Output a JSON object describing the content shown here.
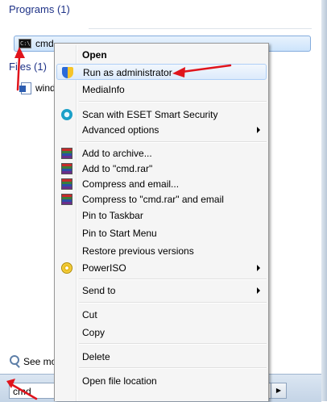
{
  "start_menu": {
    "programs_header": "Programs (1)",
    "files_header": "Files (1)",
    "program_result": {
      "label": "cmd",
      "icon": "cmd-icon"
    },
    "file_result": {
      "label": "wind",
      "icon": "word-document-icon"
    },
    "see_more": "See mo",
    "search": {
      "value": "cmd",
      "go_icon": "play-arrow-icon"
    }
  },
  "context_menu": {
    "open": "Open",
    "run_as_admin": "Run as administrator",
    "mediainfo": "MediaInfo",
    "scan_eset": "Scan with ESET Smart Security",
    "advanced_options": "Advanced options",
    "add_to_archive": "Add to archive...",
    "add_to_cmd_rar": "Add to \"cmd.rar\"",
    "compress_email": "Compress and email...",
    "compress_cmd_rar_email": "Compress to \"cmd.rar\" and email",
    "pin_taskbar": "Pin to Taskbar",
    "pin_start": "Pin to Start Menu",
    "restore_versions": "Restore previous versions",
    "poweriso": "PowerISO",
    "send_to": "Send to",
    "cut": "Cut",
    "copy": "Copy",
    "delete": "Delete",
    "open_location": "Open file location"
  },
  "colors": {
    "annotation_arrow": "#e0141c",
    "header_text": "#1e3287",
    "highlight_border": "#aecff7"
  }
}
